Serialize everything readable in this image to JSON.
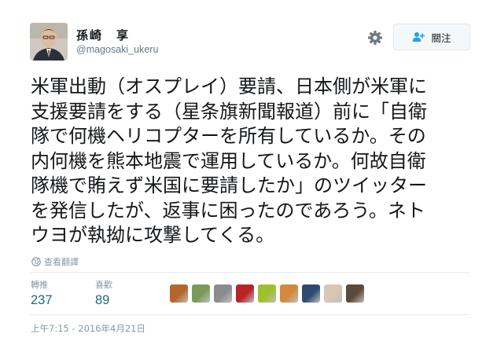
{
  "author": {
    "name": "孫崎　享",
    "handle": "@magosaki_ukeru"
  },
  "actions": {
    "settings_icon": "gear-icon",
    "follow_label": "關注",
    "follow_icon": "add-user-icon"
  },
  "tweet": {
    "lines": [
      "米軍出動（オスプレイ）要請、日本側が米軍に",
      "支援要請をする（星条旗新聞報道）前に「自衛",
      "隊で何機ヘリコプターを所有しているか。その",
      "内何機を熊本地震で運用しているか。何故自衛",
      "隊機で賄えず米国に要請したか」のツイッター",
      "を発信したが、返事に困ったのであろう。ネト",
      "ウヨが執拗に攻撃してくる。"
    ],
    "translate_label": "查看翻譯"
  },
  "stats": {
    "retweets_label": "轉推",
    "retweets_value": "237",
    "likes_label": "喜歡",
    "likes_value": "89"
  },
  "likers": [
    {
      "name": "liker-avatar-1",
      "color": "#b5652a"
    },
    {
      "name": "liker-avatar-2",
      "color": "#7a9a5a"
    },
    {
      "name": "liker-avatar-3",
      "color": "#8c8c8c"
    },
    {
      "name": "liker-avatar-4",
      "color": "#b8242a"
    },
    {
      "name": "liker-avatar-5",
      "color": "#9fc02e"
    },
    {
      "name": "liker-avatar-6",
      "color": "#d28a3a"
    },
    {
      "name": "liker-avatar-7",
      "color": "#2f4a6e"
    },
    {
      "name": "liker-avatar-8",
      "color": "#d9c6b4"
    },
    {
      "name": "liker-avatar-9",
      "color": "#5b4a3a"
    }
  ],
  "timestamp": "上午7:15 - 2016年4月21日",
  "colors": {
    "text": "#14171a",
    "muted": "#8899a6",
    "stat_value": "#1b6d73",
    "follow_icon": "#1da1f2",
    "divider": "#e6ecf0"
  }
}
